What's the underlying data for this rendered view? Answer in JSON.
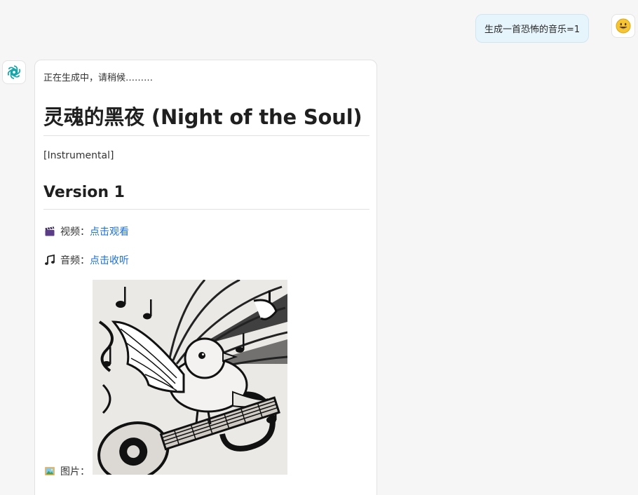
{
  "user_message": {
    "text": "生成一首恐怖的音乐=1",
    "avatar_icon": "smiling-face-emoji"
  },
  "bot_message": {
    "avatar_icon": "openai-logo-icon",
    "status": "正在生成中，请稍候………",
    "title": "灵魂的黑夜 (Night of the Soul)",
    "tag": "[Instrumental]",
    "version_title": "Version 1",
    "video": {
      "emoji": "🎬",
      "label": "视频：",
      "link_text": "点击观看"
    },
    "audio": {
      "emoji": "🎵",
      "label": "音频：",
      "link_text": "点击收听"
    },
    "image": {
      "emoji": "🖼",
      "label": "图片：",
      "subject": "black-and-white illustration of a bird with a guitar and swirling music notes"
    }
  },
  "colors": {
    "background": "#f6f6f6",
    "user_bubble": "#e6f5fb",
    "link": "#1a6fd6",
    "openai_logo": "#10a3a8"
  }
}
